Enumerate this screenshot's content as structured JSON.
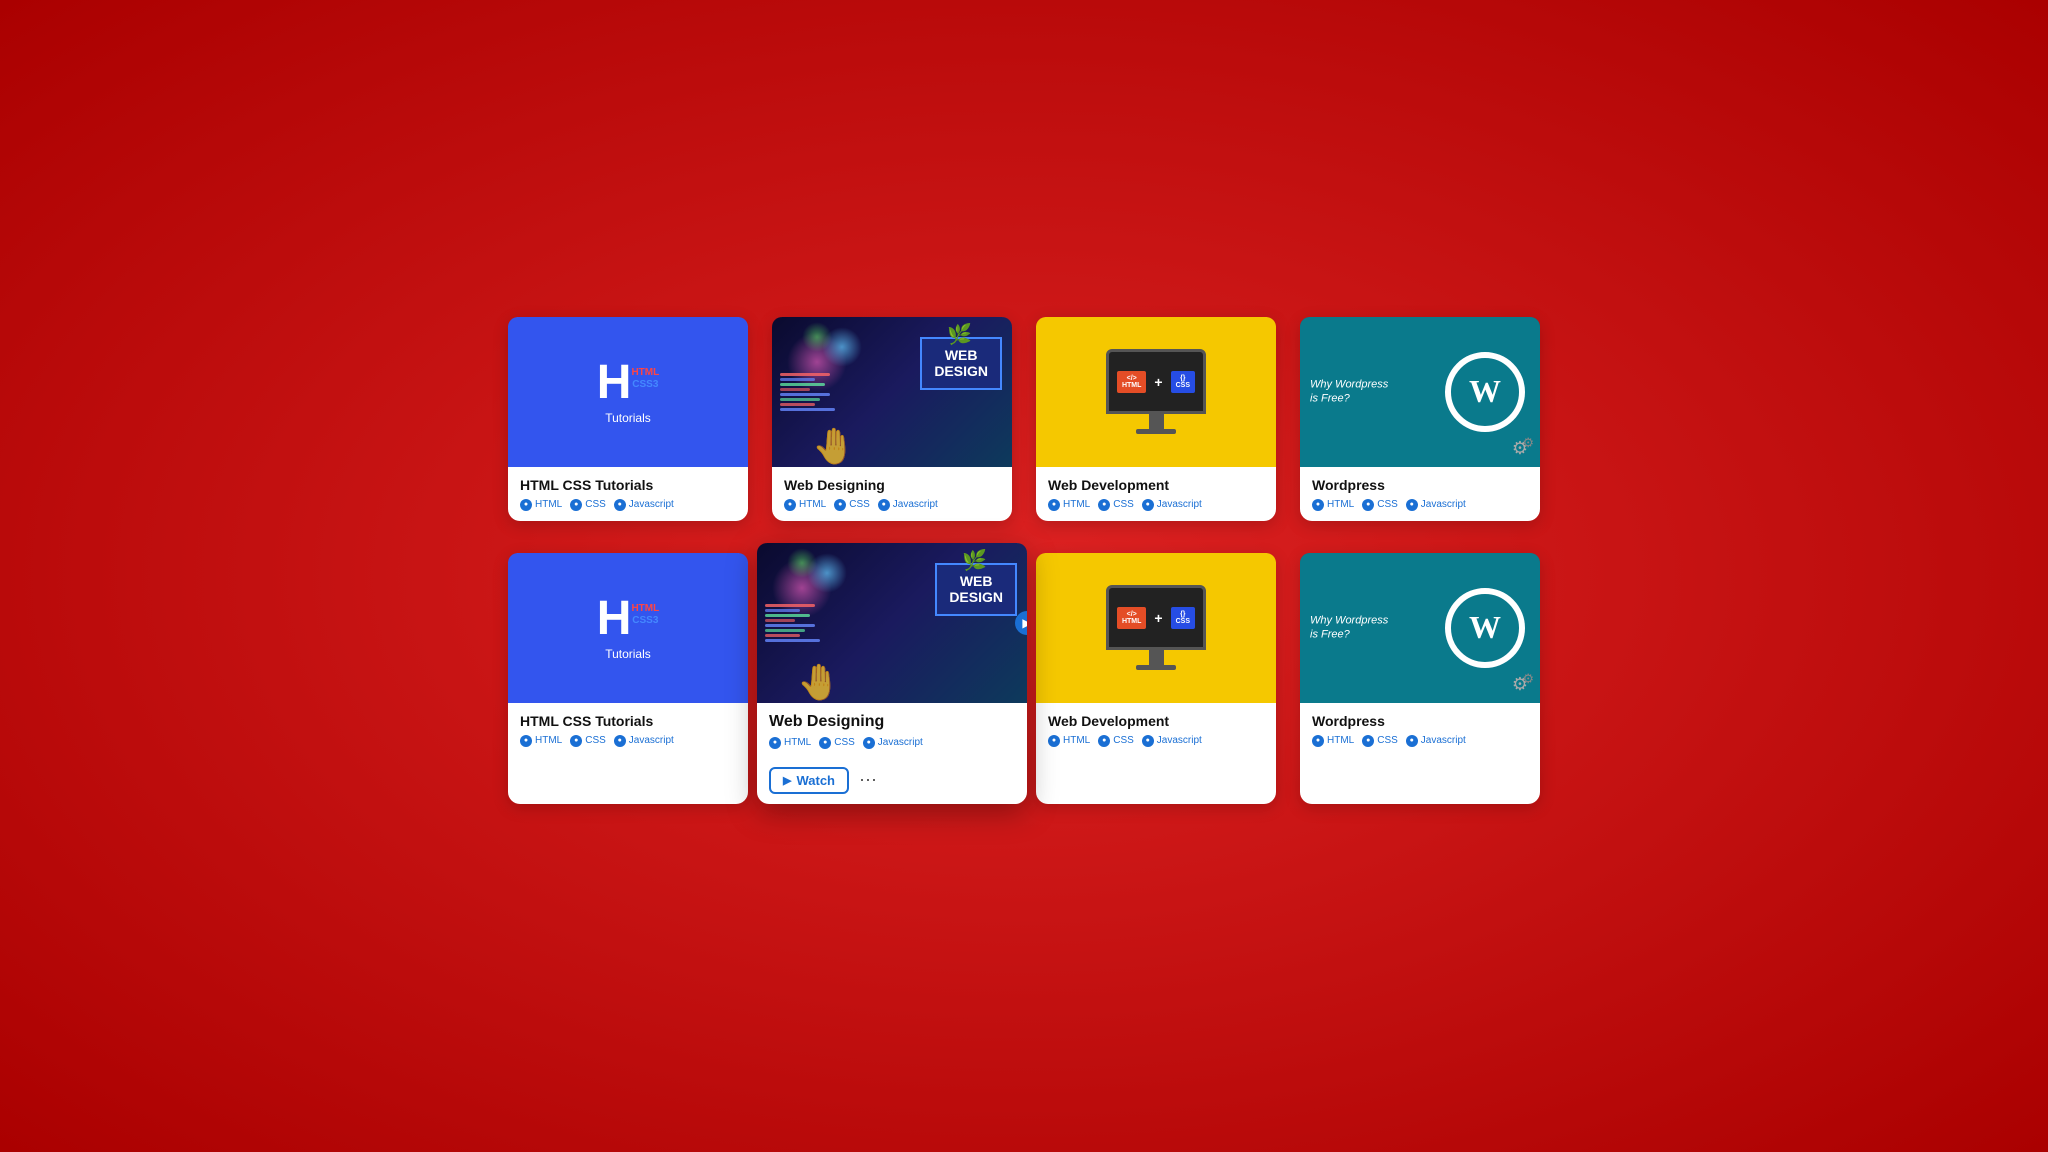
{
  "page": {
    "background_color": "#cc1111"
  },
  "row1": {
    "cards": [
      {
        "id": "html-css-1",
        "type": "html-css",
        "title": "HTML CSS Tutorials",
        "tags": [
          "HTML",
          "CSS",
          "Javascript"
        ]
      },
      {
        "id": "web-designing-1",
        "type": "web-designing",
        "title": "Web Designing",
        "tags": [
          "HTML",
          "CSS",
          "Javascript"
        ]
      },
      {
        "id": "web-dev-1",
        "type": "web-dev",
        "title": "Web Development",
        "tags": [
          "HTML",
          "CSS",
          "Javascript"
        ]
      },
      {
        "id": "wordpress-1",
        "type": "wordpress",
        "title": "Wordpress",
        "tags": [
          "HTML",
          "CSS",
          "Javascript"
        ],
        "wp_text": "Why Wordpress is Free?"
      }
    ]
  },
  "row2": {
    "cards": [
      {
        "id": "html-css-2",
        "type": "html-css",
        "title": "HTML CSS Tutorials",
        "tags": [
          "HTML",
          "CSS",
          "Javascript"
        ]
      },
      {
        "id": "web-designing-2",
        "type": "web-designing",
        "title": "Web Designing",
        "tags": [
          "HTML",
          "CSS",
          "Javascript"
        ],
        "expanded": true,
        "watch_label": "Watch",
        "share": true
      },
      {
        "id": "web-dev-2",
        "type": "web-dev",
        "title": "Web Development",
        "tags": [
          "HTML",
          "CSS",
          "Javascript"
        ]
      },
      {
        "id": "wordpress-2",
        "type": "wordpress",
        "title": "Wordpress",
        "tags": [
          "HTML",
          "CSS",
          "Javascript"
        ],
        "wp_text": "Why Wordpress is Free?"
      }
    ]
  },
  "labels": {
    "html_text": "HTML",
    "css_text": "CSS3",
    "tutorials": "Tutorials",
    "web": "WEB",
    "design": "DESIGN",
    "watch": "Watch",
    "html_badge": "</>\nHTML",
    "css_badge": "{}\nCSS",
    "plus": "+",
    "wp_free": "Why Wordpress is Free?"
  }
}
